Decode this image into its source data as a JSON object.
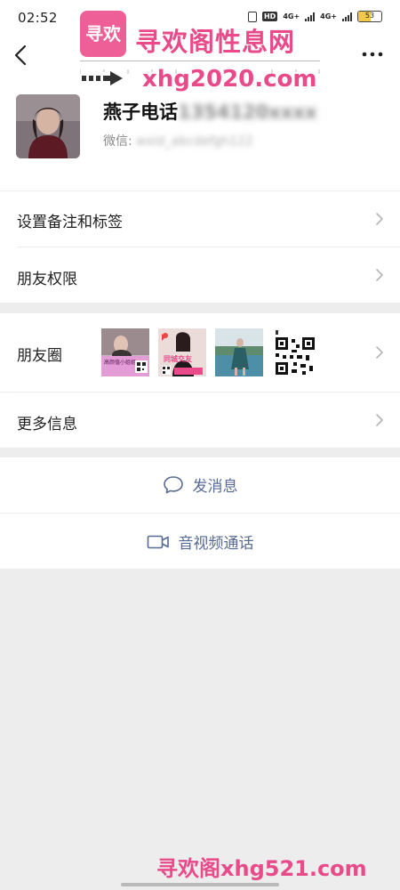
{
  "status_bar": {
    "time": "02:52",
    "hd_label": "HD",
    "network_1": "4G+",
    "network_2": "4G+",
    "battery_level": "53"
  },
  "watermark": {
    "logo_text": "寻欢",
    "site_title": "寻欢阁性息网",
    "site_url": "xhg2020.com",
    "bottom_text": "寻欢阁xhg521.com"
  },
  "profile": {
    "name_visible": "燕子电话",
    "name_obscured": "1354120xxxx",
    "wechat_prefix": "微信",
    "wechat_obscured": "wxid_abcdefgh122"
  },
  "rows": {
    "remark_tags": "设置备注和标签",
    "friend_permissions": "朋友权限",
    "moments": "朋友圈",
    "more_info": "更多信息"
  },
  "actions": {
    "send_message": "发消息",
    "av_call": "音视频通话"
  },
  "moments_thumbs": {
    "thumb1_text": "高颜值小姐姐",
    "thumb2_text": "同城交友"
  },
  "colors": {
    "link_blue": "#576b95",
    "watermark_pink": "#e84a8a",
    "page_background": "#ededed"
  }
}
